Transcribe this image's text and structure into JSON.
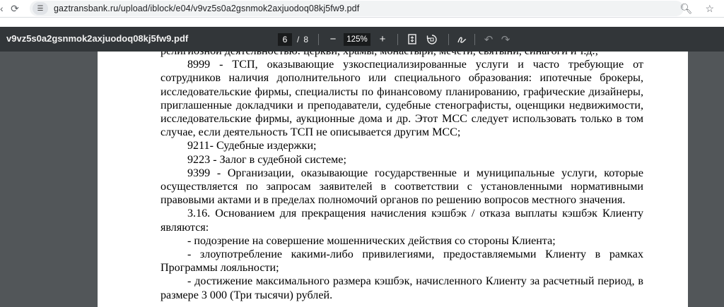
{
  "browser": {
    "url": "gaztransbank.ru/upload/iblock/e04/v9vz5s0a2gsnmok2axjuodoq08kj5fw9.pdf",
    "icons": [
      "back-icon",
      "reload-icon",
      "site-settings-icon",
      "zoom-icon",
      "bookmark-star-icon"
    ]
  },
  "pdf_toolbar": {
    "filename": "v9vz5s0a2gsnmok2axjuodoq08kj5fw9.pdf",
    "current_page": "6",
    "page_separator": "/",
    "total_pages": "8",
    "zoom": "125%",
    "zoom_out": "−",
    "zoom_in": "+",
    "icons": [
      "fit-page-icon",
      "rotate-icon",
      "annotate-icon",
      "undo-icon",
      "redo-icon"
    ]
  },
  "document": {
    "lines": [
      "религиозной деятельностью: церкви, храмы, монастыри, мечети, святыни, синагоги и т.д.;",
      "8999 - ТСП, оказывающие узкоспециализированные услуги и часто требующие от сотрудников наличия дополнительного или специального образования: ипотечные брокеры, исследовательские фирмы, специалисты по финансовому планированию, графические дизайнеры, приглашенные докладчики и преподаватели, судебные стенографисты, оценщики недвижимости, исследовательские фирмы, аукционные дома и др. Этот МСС следует использовать только в том случае, если деятельность ТСП не описывается другим МСС;",
      "9211- Судебные издержки;",
      "9223 - Залог в судебной системе;",
      "9399 - Организации, оказывающие государственные и муниципальные услуги, которые осуществляется по запросам заявителей в соответствии с установленными нормативными правовыми актами и в пределах полномочий органов по решению вопросов местного значения.",
      "3.16. Основанием для прекращения начисления кэшбэк / отказа выплаты кэшбэк Клиенту являются:",
      "- подозрение на совершение мошеннических действия со стороны Клиента;",
      "- злоупотребление какими-либо привилегиями, предоставляемыми Клиенту в рамках Программы лояльности;",
      "- достижение максимального размера кэшбэк, начисленного Клиенту за расчетный период, в размере 3 000 (Три тысячи) рублей."
    ]
  }
}
